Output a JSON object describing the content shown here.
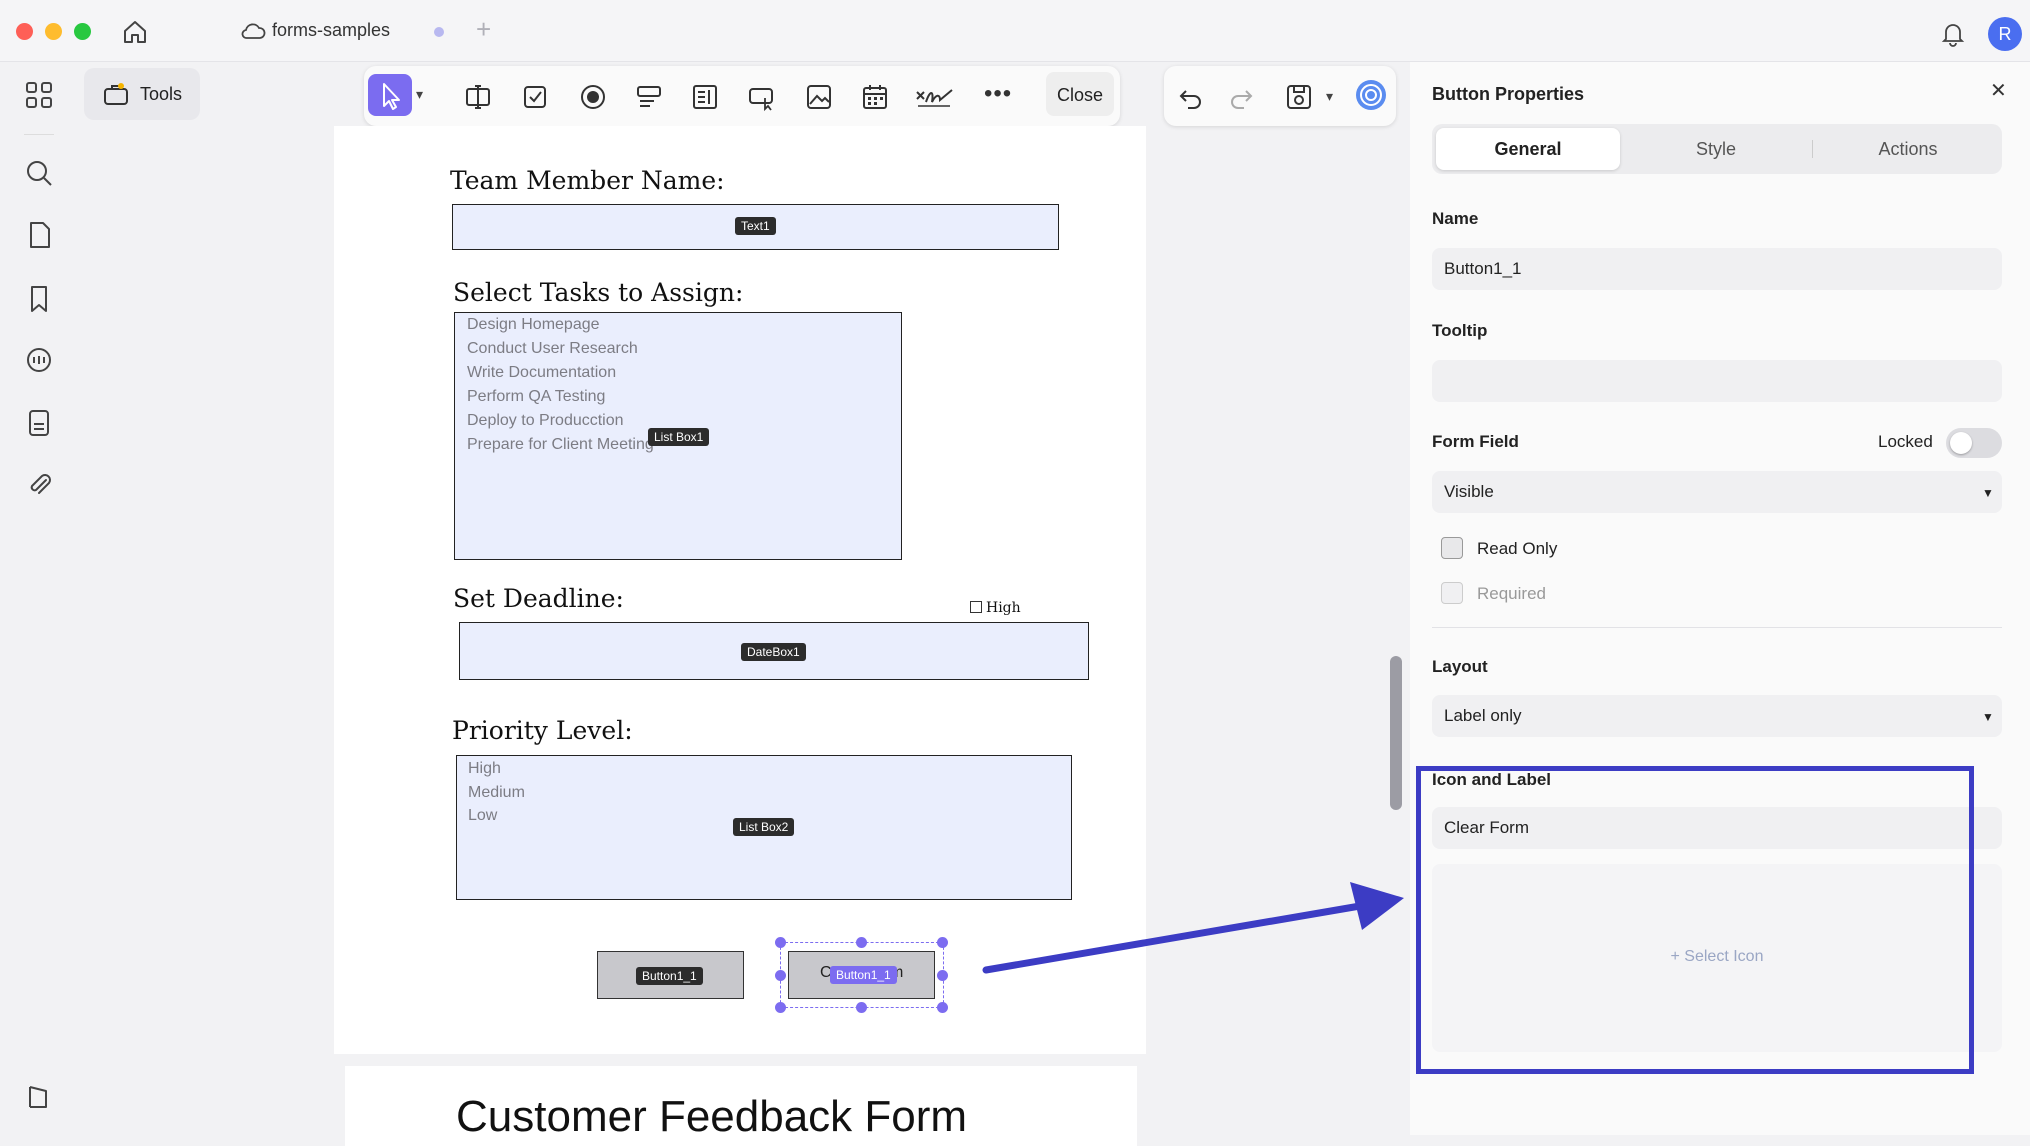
{
  "window": {
    "tab_title": "forms-samples",
    "avatar_initial": "R"
  },
  "sidebar": {
    "tools_label": "Tools"
  },
  "toolbar": {
    "close_label": "Close"
  },
  "document": {
    "sections": {
      "team_member_heading": "Team Member Name:",
      "select_tasks_heading": "Select Tasks to Assign:",
      "set_deadline_heading": "Set Deadline:",
      "priority_heading": "Priority Level:",
      "next_page_heading": "Customer Feedback Form"
    },
    "fields": {
      "text1_tag": "Text1",
      "listbox1_tag": "List Box1",
      "listbox1_items": [
        "Design Homepage",
        "Conduct User Research",
        "Write Documentation",
        "Perform QA Testing",
        "Deploy to Producction",
        "Prepare for Client Meeting"
      ],
      "checkbox_label": "High",
      "datebox_tag": "DateBox1",
      "listbox2_tag": "List Box2",
      "listbox2_items": [
        "High",
        "Medium",
        "Low"
      ],
      "button1_tag": "Button1_1",
      "button2_tag": "Button1_1",
      "button2_text_left": "C",
      "button2_text_right": "m"
    }
  },
  "panel": {
    "title": "Button Properties",
    "tabs": [
      "General",
      "Style",
      "Actions"
    ],
    "active_tab": "General",
    "name_label": "Name",
    "name_value": "Button1_1",
    "tooltip_label": "Tooltip",
    "tooltip_value": "",
    "form_field_label": "Form Field",
    "locked_label": "Locked",
    "visibility_value": "Visible",
    "read_only_label": "Read Only",
    "required_label": "Required",
    "layout_label": "Layout",
    "layout_value": "Label only",
    "icon_label_heading": "Icon and Label",
    "label_value": "Clear Form",
    "select_icon_label": "+ Select Icon"
  },
  "colors": {
    "accent": "#7b6cf0",
    "annotation": "#3c3cc4",
    "field_fill": "#eaeefd"
  }
}
